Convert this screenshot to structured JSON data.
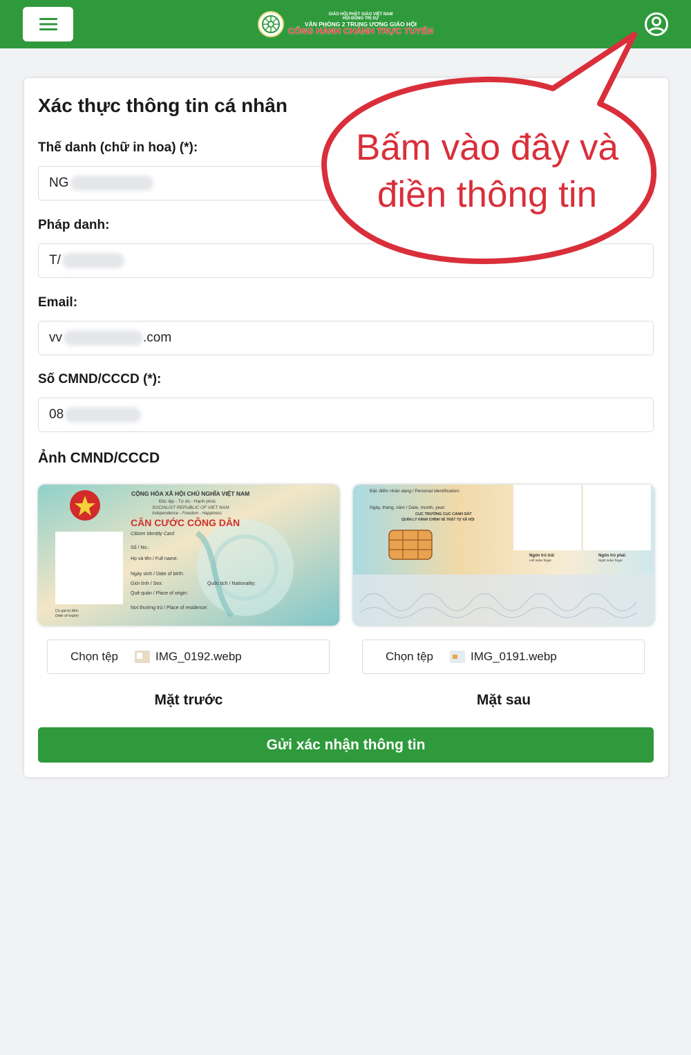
{
  "header": {
    "logo_lines": [
      "GIÁO HỘI PHẬT GIÁO VIỆT NAM",
      "HỘI ĐỒNG TRỊ SỰ",
      "VĂN PHÒNG 2 TRUNG ƯƠNG GIÁO HỘI",
      "CỔNG HÀNH CHÁNH TRỰC TUYẾN"
    ],
    "menu_icon": "hamburger-menu-icon",
    "user_icon": "user-account-icon",
    "bar_color": "#2f9a3c"
  },
  "form": {
    "title": "Xác thực thông tin cá nhân",
    "fields": [
      {
        "label": "Thế danh (chữ in hoa) (*):",
        "value": "NG"
      },
      {
        "label": "Pháp danh:",
        "value": "T/"
      },
      {
        "label": "Email:",
        "value_prefix": "vv",
        "value_suffix": ".com"
      },
      {
        "label": "Số CMND/CCCD (*):",
        "value": "08"
      }
    ],
    "id_section_title": "Ảnh CMND/CCCD",
    "front": {
      "file_button": "Chọn tệp",
      "file_name": "IMG_0192.webp",
      "caption": "Mặt trước",
      "card_lines": [
        "CỘNG HÒA XÃ HỘI CHỦ NGHĨA VIỆT NAM",
        "Độc lập - Tự do - Hạnh phúc",
        "SOCIALIST REPUBLIC OF VIET NAM",
        "Independence - Freedom - Happiness",
        "CĂN CƯỚC CÔNG DÂN",
        "Citizen Identity Card",
        "Số / No.:",
        "Họ và tên / Full name:",
        "Ngày sinh / Date of birth:",
        "Giới tính / Sex:",
        "Quốc tịch / Nationality:",
        "Quê quán / Place of origin:",
        "Nơi thường trú / Place of residence:",
        "Có giá trị đến:",
        "Date of expiry"
      ]
    },
    "back": {
      "file_button": "Chọn tệp",
      "file_name": "IMG_0191.webp",
      "caption": "Mặt sau",
      "card_lines": [
        "Đặc điểm nhân dạng / Personal identification:",
        "Ngày, tháng, năm / Date, month, year:",
        "CỤC TRƯỞNG CỤC CẢNH SÁT",
        "QUẢN LÝ HÀNH CHÍNH VỀ TRẬT TỰ XÃ HỘI",
        "Ngón trỏ trái",
        "Left index finger",
        "Ngón trỏ phải",
        "Right index finger"
      ]
    },
    "submit_label": "Gửi xác nhận thông tin"
  },
  "annotation": {
    "line1": "Bấm vào đây và",
    "line2": "điền thông tin",
    "color": "#d92f3a"
  }
}
